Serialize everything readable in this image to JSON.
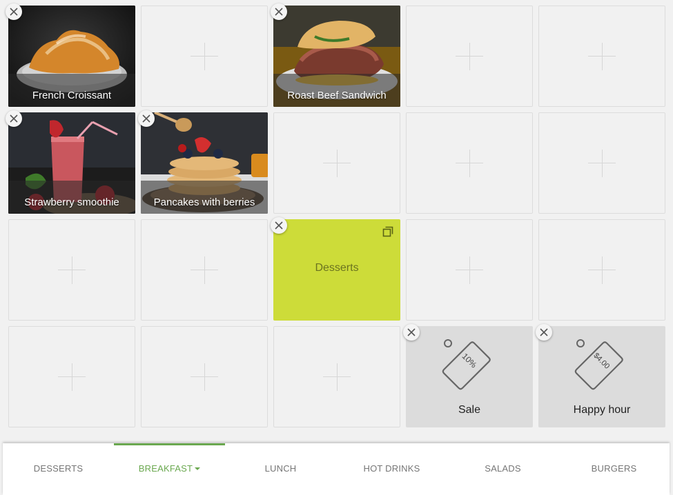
{
  "grid": {
    "tiles": [
      {
        "type": "photo",
        "label": "French Croissant",
        "image": "croissant"
      },
      {
        "type": "empty"
      },
      {
        "type": "photo",
        "label": "Roast Beef Sandwich",
        "image": "sandwich"
      },
      {
        "type": "empty"
      },
      {
        "type": "empty"
      },
      {
        "type": "photo",
        "label": "Strawberry smoothie",
        "image": "smoothie"
      },
      {
        "type": "photo",
        "label": "Pancakes with berries",
        "image": "pancakes"
      },
      {
        "type": "empty"
      },
      {
        "type": "empty"
      },
      {
        "type": "empty"
      },
      {
        "type": "empty"
      },
      {
        "type": "empty"
      },
      {
        "type": "category",
        "label": "Desserts",
        "color": "#cddc39"
      },
      {
        "type": "empty"
      },
      {
        "type": "empty"
      },
      {
        "type": "empty"
      },
      {
        "type": "empty"
      },
      {
        "type": "empty"
      },
      {
        "type": "discount",
        "label": "Sale",
        "tag_text": "10%"
      },
      {
        "type": "discount",
        "label": "Happy hour",
        "tag_text": "$4.00"
      }
    ]
  },
  "tabs": [
    {
      "label": "DESSERTS",
      "active": false
    },
    {
      "label": "BREAKFAST",
      "active": true,
      "has_dropdown": true
    },
    {
      "label": "LUNCH",
      "active": false
    },
    {
      "label": "HOT DRINKS",
      "active": false
    },
    {
      "label": "SALADS",
      "active": false
    },
    {
      "label": "BURGERS",
      "active": false
    }
  ],
  "colors": {
    "accent": "#6aa84f",
    "category_tile": "#cddc39",
    "discount_tile": "#dcdcdc",
    "background": "#f1f1f1"
  }
}
